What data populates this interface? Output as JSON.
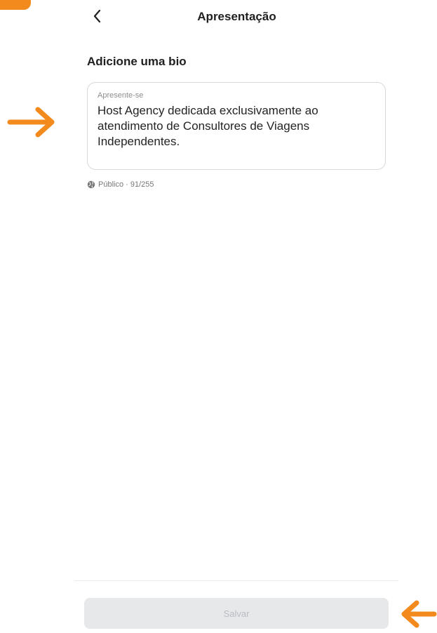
{
  "header": {
    "title": "Apresentação",
    "back_icon": "chevron-left-icon"
  },
  "section": {
    "title": "Adicione uma bio"
  },
  "bio_field": {
    "label": "Apresente-se",
    "value": "Host Agency dedicada exclusivamente ao\natendimento de Consultores de Viagens\nIndependentes."
  },
  "privacy": {
    "icon": "globe-icon",
    "text": "Público · 91/255"
  },
  "footer": {
    "save_label": "Salvar"
  },
  "annotations": {
    "arrow_icon": "arrow-icon",
    "accent_color": "#f28a1d"
  }
}
